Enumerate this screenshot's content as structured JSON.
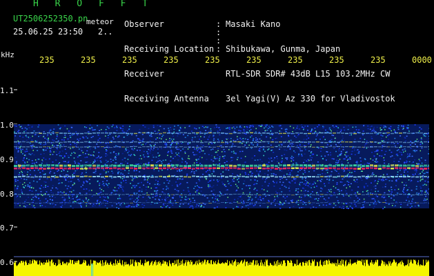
{
  "brand": "HROFFT",
  "file_name": "UT2506252350.pn",
  "detection_label": "meteor",
  "datetime": "25.06.25 23:50",
  "datetime_suffix": "2..",
  "header": {
    "rows": [
      {
        "label": "Observer",
        "value": "Masaki Kano"
      },
      {
        "label": "Receiving Location",
        "value": "Shibukawa, Gunma, Japan"
      },
      {
        "label": "Receiver",
        "value": "RTL-SDR SDR# 43dB L15 103.2MHz CW"
      },
      {
        "label": "Receiving Antenna",
        "value": "3el Yagi(V) Az 330 for Vladivostok"
      }
    ]
  },
  "y_axis": {
    "unit": "kHz",
    "ticks": [
      "1.1",
      "1.0",
      "0.9",
      "0.8",
      "0.7",
      "0.6"
    ]
  },
  "x_axis": {
    "ticks": [
      "235",
      "235",
      "235",
      "235",
      "235",
      "235",
      "235",
      "235",
      "235",
      "0000"
    ]
  },
  "colors": {
    "background": "#000000",
    "text_green": "#39d64a",
    "text_white": "#f2f2f2",
    "text_yellow": "#f0f04a",
    "noise_blue": "#1e3cff",
    "carrier_red": "#ff2a5a",
    "audio_yellow": "#f5f500"
  }
}
